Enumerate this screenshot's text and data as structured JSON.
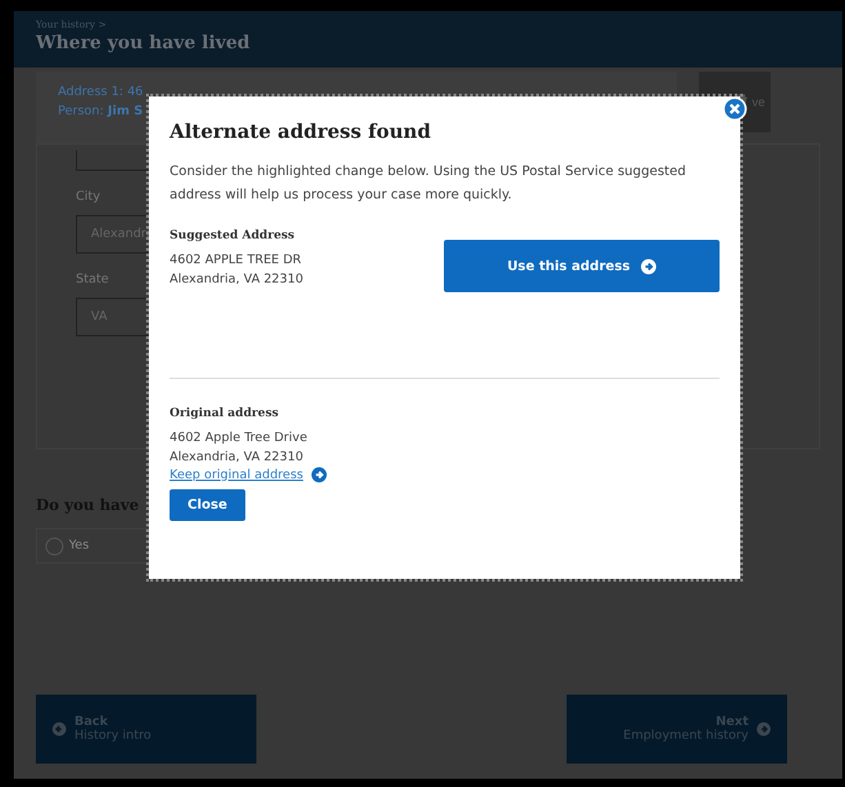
{
  "header": {
    "breadcrumb": "Your history >",
    "title": "Where you have lived"
  },
  "address_card": {
    "address": "Address 1: 46",
    "person_label": "Person: ",
    "person_name": "Jim S",
    "remove_label": "ve"
  },
  "form": {
    "fields": [
      {
        "label": "City",
        "value": "Alexandri"
      },
      {
        "label": "State",
        "value": "VA"
      }
    ]
  },
  "question": {
    "text": "Do you have",
    "options": [
      {
        "label": "Yes",
        "selected": false
      }
    ]
  },
  "footer": {
    "back": {
      "label": "Back",
      "sub": "History intro"
    },
    "next": {
      "label": "Next",
      "sub": "Employment history"
    }
  },
  "modal": {
    "title": "Alternate address found",
    "message": "Consider the highlighted change below. Using the US Postal Service suggested address will help us process your case more quickly.",
    "suggested": {
      "heading": "Suggested Address",
      "lines": [
        "4602 APPLE TREE DR",
        "Alexandria, VA 22310"
      ],
      "button": "Use this address"
    },
    "original": {
      "heading": "Original address",
      "lines": [
        "4602 Apple Tree Drive",
        "Alexandria, VA 22310"
      ],
      "link": "Keep original address"
    },
    "close_button": "Close"
  }
}
